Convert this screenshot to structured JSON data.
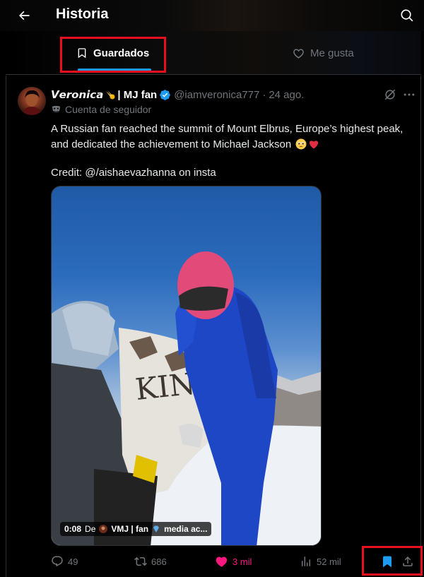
{
  "header": {
    "title": "Historia",
    "back_icon": "arrow-left-icon",
    "search_icon": "search-icon"
  },
  "tabs": [
    {
      "label": "Guardados",
      "icon": "bookmark-icon",
      "active": true
    },
    {
      "label": "Me gusta",
      "icon": "heart-icon",
      "active": false
    }
  ],
  "tweet": {
    "author_name": "𝙑𝙚𝙧𝙤𝙣𝙞𝙘𝙖",
    "author_suffix": "| MJ fan",
    "handle": "@iamveronica777",
    "separator": "·",
    "date": "24 ago.",
    "follower_label": "Cuenta de seguidor",
    "text_line1": "A Russian fan reached the summit of Mount Elbrus, Europe’s highest peak, and dedicated the achievement to Michael Jackson",
    "text_line2": "Credit: @/aishaevazhanna on insta",
    "video": {
      "time": "0:08",
      "from_label": "De",
      "source": "VMJ | fan",
      "source_rest": "media ac..."
    },
    "stats": {
      "replies": "49",
      "reposts": "686",
      "likes": "3 mil",
      "views": "52 mil"
    }
  },
  "colors": {
    "accent": "#1d9bf0",
    "like": "#f91880",
    "highlight_box": "#e8101d",
    "muted": "#71767b"
  }
}
